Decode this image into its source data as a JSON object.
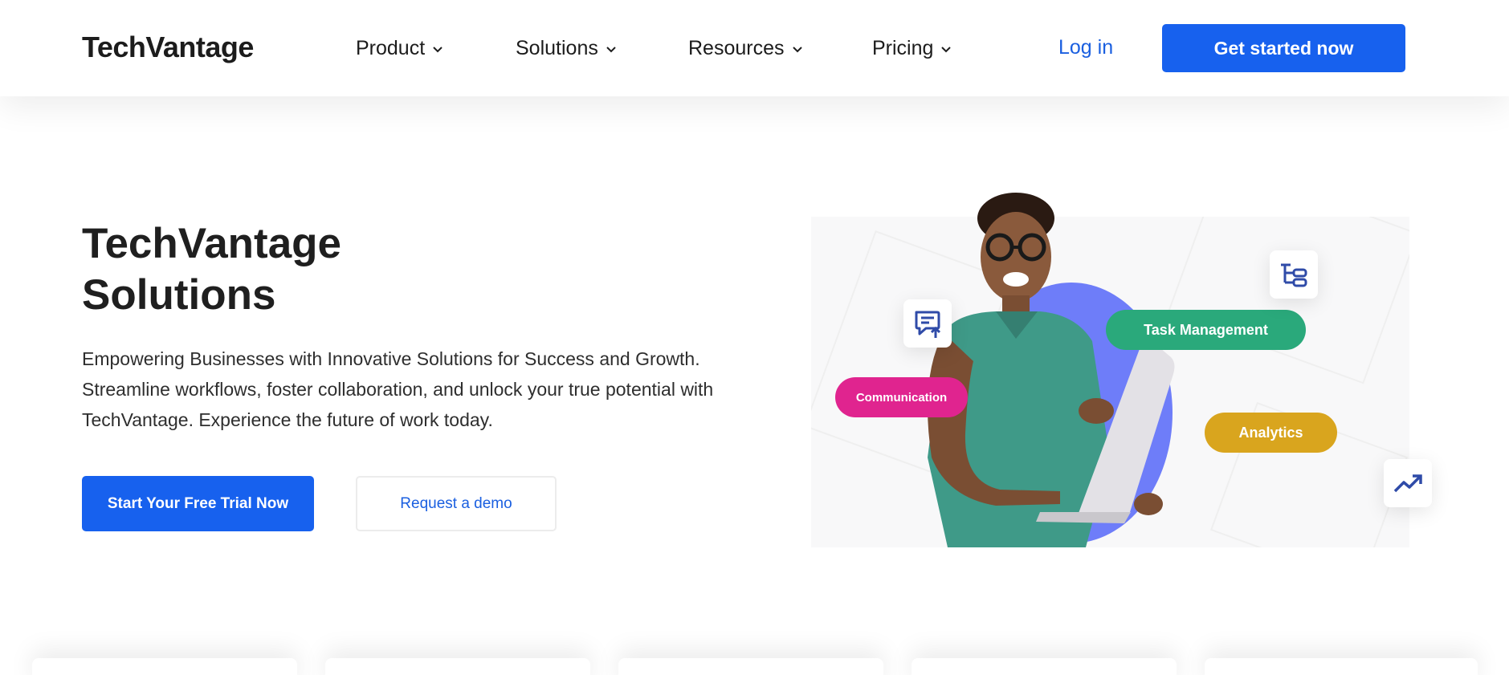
{
  "brand": {
    "name": "TechVantage"
  },
  "nav": {
    "items": [
      {
        "label": "Product"
      },
      {
        "label": "Solutions"
      },
      {
        "label": "Resources"
      },
      {
        "label": "Pricing"
      }
    ],
    "login_label": "Log in",
    "cta_label": "Get started now"
  },
  "hero": {
    "title_line1": "TechVantage",
    "title_line2": "Solutions",
    "description": "Empowering Businesses with Innovative Solutions for Success and Growth. Streamline workflows, foster collaboration, and unlock your true potential with TechVantage. Experience the future of work today.",
    "primary_button": "Start Your Free Trial Now",
    "secondary_button": "Request a demo"
  },
  "visual": {
    "tags": {
      "communication": "Communication",
      "task_management": "Task Management",
      "analytics": "Analytics"
    },
    "icons": [
      "chat-upload-icon",
      "hierarchy-icon",
      "trending-up-icon"
    ]
  },
  "colors": {
    "primary": "#1761ee",
    "link": "#1a5fe0",
    "communication": "#e0248f",
    "task_management": "#2aa97b",
    "analytics": "#d9a51e",
    "circle": "#6e7df9"
  }
}
